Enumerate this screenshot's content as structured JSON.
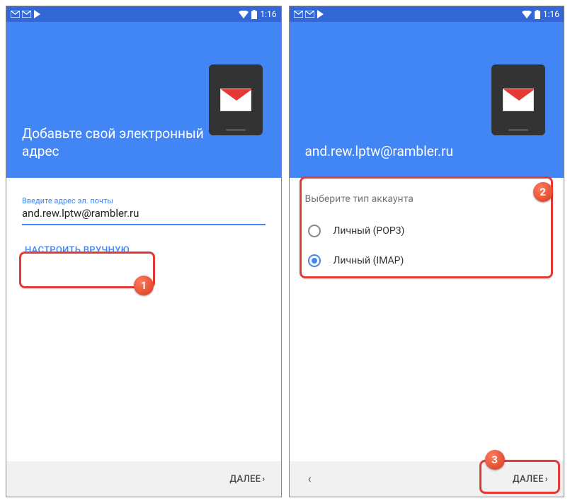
{
  "status": {
    "time": "1:16"
  },
  "screen1": {
    "title": "Добавьте свой электронный адрес",
    "input_label": "Введите адрес эл. почты",
    "input_value": "and.rew.lptw@rambler.ru",
    "manual": "НАСТРОИТЬ ВРУЧНУЮ",
    "next": "ДАЛЕЕ"
  },
  "screen2": {
    "title": "and.rew.lptw@rambler.ru",
    "section": "Выберите тип аккаунта",
    "options": [
      {
        "label": "Личный (POP3)",
        "checked": false
      },
      {
        "label": "Личный (IMAP)",
        "checked": true
      }
    ],
    "next": "ДАЛЕЕ"
  },
  "annotations": {
    "b1": "1",
    "b2": "2",
    "b3": "3"
  }
}
